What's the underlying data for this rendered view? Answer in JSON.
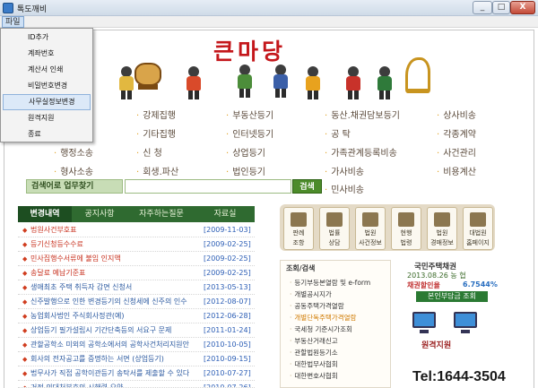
{
  "window": {
    "title": "톡도깨비",
    "min": "_",
    "max": "□",
    "close": "X"
  },
  "menubar": {
    "file": "파일"
  },
  "file_menu": [
    "ID추가",
    "계좌번호",
    "계산서 인쇄",
    "비밀번호변경",
    "사무실정보변경",
    "원격지원",
    "종료"
  ],
  "logo": "큰마당",
  "categories": {
    "row1": [
      "강제집행",
      "부동산등기",
      "동산.채권담보등기",
      "상사비송"
    ],
    "row2": [
      "기타집행",
      "인터넷등기",
      "공    탁",
      "각종계약"
    ],
    "row3": [
      "행정소송",
      "신    청",
      "상업등기",
      "가족관계등록비송",
      "사건관리"
    ],
    "row4": [
      "형사소송",
      "회생.파산",
      "법인등기",
      "가사비송",
      "비용계산"
    ],
    "row5": [
      "민사비송"
    ]
  },
  "search": {
    "label": "검색어로 업무찾기",
    "button": "검색",
    "value": ""
  },
  "tabs": [
    "변경내역",
    "공지사항",
    "자주하는질문",
    "자료실"
  ],
  "news": [
    {
      "title": "법원사건부호표",
      "date": "[2009-11-03]",
      "color": "red"
    },
    {
      "title": "등기신청등수수료",
      "date": "[2009-02-25]",
      "color": "red"
    },
    {
      "title": "민사집행수서류에 불임 인지액",
      "date": "[2009-02-25]",
      "color": "red"
    },
    {
      "title": "송달료 예납기준표",
      "date": "[2009-02-25]",
      "color": "red"
    },
    {
      "title": "생애최초 주택 취득자 감면 신청서",
      "date": "[2013-05-13]",
      "color": "blue"
    },
    {
      "title": "신주발행으로 인한 변경등기의 신청세에 신주의 인수",
      "date": "[2012-08-07]",
      "color": "blue"
    },
    {
      "title": "농업회사법인 주식회사정관(예)",
      "date": "[2012-06-28]",
      "color": "blue"
    },
    {
      "title": "상업등기 필가설립시 기간단축등의 서요구 문제",
      "date": "[2011-01-24]",
      "color": "blue"
    },
    {
      "title": "관할공학소 미외의 공학소에서의 공학사건처리지원안",
      "date": "[2010-10-05]",
      "color": "blue"
    },
    {
      "title": "회사의 전자공고를 증명하는 서면 (상업등기)",
      "date": "[2010-09-15]",
      "color": "blue"
    },
    {
      "title": "법무사가 직접 공학이관등기 송탁서를 제출할 수 있다",
      "date": "[2010-07-27]",
      "color": "blue"
    },
    {
      "title": "거정 의대처분호의 시해령 요약",
      "date": "[2010-07-26]",
      "color": "blue"
    }
  ],
  "services": [
    {
      "label1": "판례",
      "label2": "조항"
    },
    {
      "label1": "법률",
      "label2": "상담"
    },
    {
      "label1": "법원",
      "label2": "사건정보"
    },
    {
      "label1": "현행",
      "label2": "법령"
    },
    {
      "label1": "법원",
      "label2": "경매정보"
    },
    {
      "label1": "대법원",
      "label2": "홈페이지"
    }
  ],
  "lookup": {
    "title": "조회/검색",
    "items": [
      "등기부등본열람 및 e-form",
      "개별공시지가",
      "공동주택가격열람",
      "개별단독주택가격열람",
      "국세청 기준시가조회",
      "부동산거래신고",
      "관할법원등기소",
      "대한법무사협회",
      "대한변호사협회"
    ]
  },
  "bond": {
    "title": "국민주택채권",
    "date": "2013.08.26 농 협",
    "rate_label": "채권할인율",
    "rate": "6.7544%",
    "button": "본인부담금 조회"
  },
  "remote": {
    "label": "원격지원"
  },
  "tel": "Tel:1644-3504"
}
